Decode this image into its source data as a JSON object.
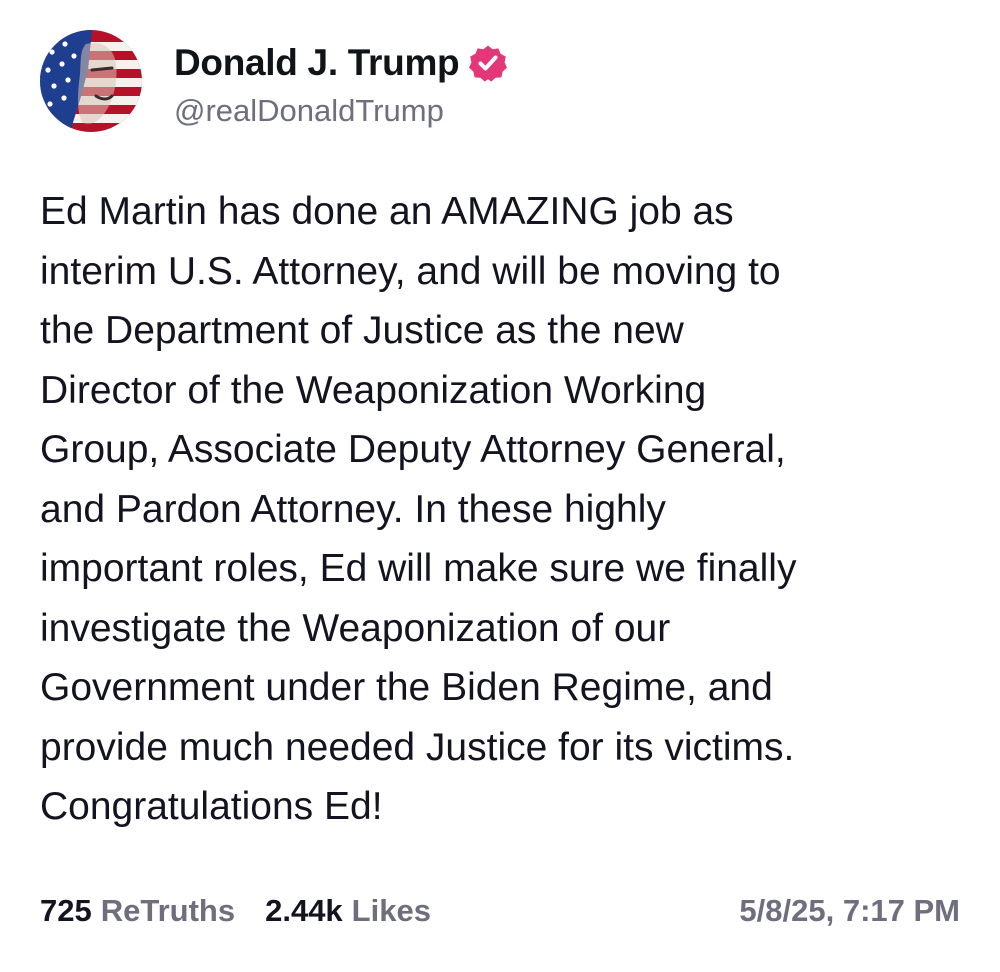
{
  "profile": {
    "display_name": "Donald J. Trump",
    "handle": "@realDonaldTrump",
    "avatar_icon": "flag-portrait-avatar",
    "verified_icon": "verified-badge-icon",
    "verified_color": "#e3377a"
  },
  "post": {
    "text": "Ed Martin has done an AMAZING job as\ninterim U.S. Attorney, and will be moving to\nthe Department of Justice as the new\nDirector of the Weaponization Working\nGroup, Associate Deputy Attorney General,\nand Pardon Attorney. In these highly\nimportant roles, Ed will make sure we finally\ninvestigate the Weaponization of our\nGovernment under the Biden Regime, and\nprovide much needed Justice for its victims.\nCongratulations Ed!"
  },
  "stats": {
    "retruths_count": "725",
    "retruths_label": "ReTruths",
    "likes_count": "2.44k",
    "likes_label": "Likes",
    "timestamp": "5/8/25, 7:17 PM"
  }
}
